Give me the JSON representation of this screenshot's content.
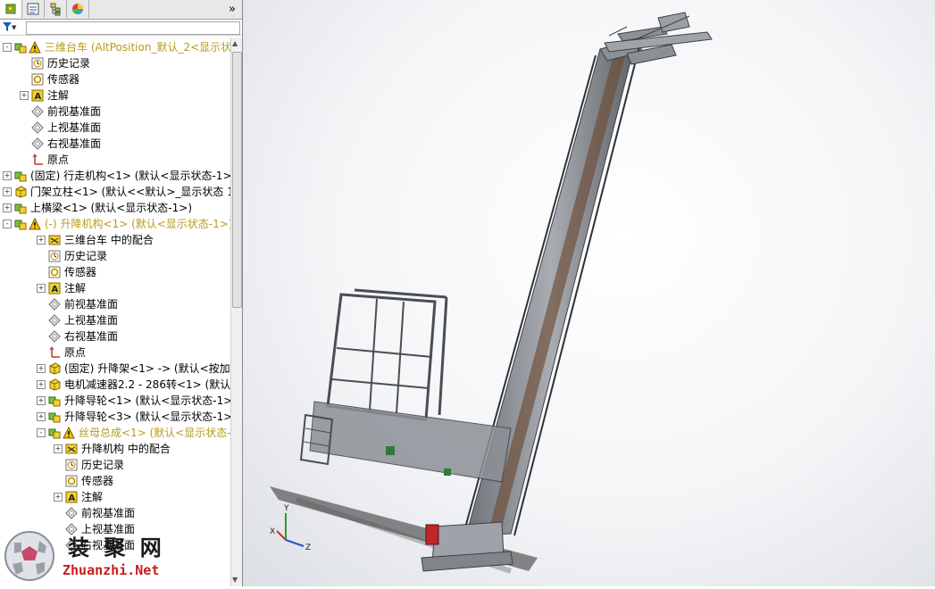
{
  "panel": {
    "tabs": [
      "feature-manager-tab",
      "property-manager-tab",
      "configuration-manager-tab",
      "display-manager-tab"
    ],
    "more_label": "»",
    "filter_icon_label": "▼"
  },
  "tree": {
    "rows": [
      {
        "label": "三维台车  (AltPosition_默认_2<显示状态-",
        "indent": 0,
        "expand": "-",
        "icon": "assembly-icon",
        "warn": true,
        "yellow": true
      },
      {
        "label": "历史记录",
        "indent": 1,
        "expand": "",
        "icon": "history-icon",
        "warn": false,
        "yellow": false
      },
      {
        "label": "传感器",
        "indent": 1,
        "expand": "",
        "icon": "sensor-icon",
        "warn": false,
        "yellow": false
      },
      {
        "label": "注解",
        "indent": 1,
        "expand": "+",
        "icon": "annotation-icon",
        "warn": false,
        "yellow": false
      },
      {
        "label": "前视基准面",
        "indent": 1,
        "expand": "",
        "icon": "plane-icon",
        "warn": false,
        "yellow": false
      },
      {
        "label": "上视基准面",
        "indent": 1,
        "expand": "",
        "icon": "plane-icon",
        "warn": false,
        "yellow": false
      },
      {
        "label": "右视基准面",
        "indent": 1,
        "expand": "",
        "icon": "plane-icon",
        "warn": false,
        "yellow": false
      },
      {
        "label": "原点",
        "indent": 1,
        "expand": "",
        "icon": "origin-icon",
        "warn": false,
        "yellow": false
      },
      {
        "label": "(固定) 行走机构<1> (默认<显示状态-1>",
        "indent": 0,
        "expand": "+",
        "icon": "assembly-icon",
        "warn": false,
        "yellow": false
      },
      {
        "label": "门架立柱<1> (默认<<默认>_显示状态 1",
        "indent": 0,
        "expand": "+",
        "icon": "part-icon",
        "warn": false,
        "yellow": false
      },
      {
        "label": "上横梁<1> (默认<显示状态-1>)",
        "indent": 0,
        "expand": "+",
        "icon": "assembly-icon",
        "warn": false,
        "yellow": false
      },
      {
        "label": "(-) 升降机构<1> (默认<显示状态-1>)",
        "indent": 0,
        "expand": "-",
        "icon": "assembly-icon",
        "warn": true,
        "yellow": true
      },
      {
        "label": "三维台车 中的配合",
        "indent": 2,
        "expand": "+",
        "icon": "mates-icon",
        "warn": false,
        "yellow": false
      },
      {
        "label": "历史记录",
        "indent": 2,
        "expand": "",
        "icon": "history-icon",
        "warn": false,
        "yellow": false
      },
      {
        "label": "传感器",
        "indent": 2,
        "expand": "",
        "icon": "sensor-icon",
        "warn": false,
        "yellow": false
      },
      {
        "label": "注解",
        "indent": 2,
        "expand": "+",
        "icon": "annotation-icon",
        "warn": false,
        "yellow": false
      },
      {
        "label": "前视基准面",
        "indent": 2,
        "expand": "",
        "icon": "plane-icon",
        "warn": false,
        "yellow": false
      },
      {
        "label": "上视基准面",
        "indent": 2,
        "expand": "",
        "icon": "plane-icon",
        "warn": false,
        "yellow": false
      },
      {
        "label": "右视基准面",
        "indent": 2,
        "expand": "",
        "icon": "plane-icon",
        "warn": false,
        "yellow": false
      },
      {
        "label": "原点",
        "indent": 2,
        "expand": "",
        "icon": "origin-icon",
        "warn": false,
        "yellow": false
      },
      {
        "label": "(固定) 升降架<1> -> (默认<按加工>",
        "indent": 2,
        "expand": "+",
        "icon": "part-icon",
        "warn": false,
        "yellow": false
      },
      {
        "label": "电机减速器2.2 - 286转<1> (默认<<默",
        "indent": 2,
        "expand": "+",
        "icon": "part-icon",
        "warn": false,
        "yellow": false
      },
      {
        "label": "升降导轮<1> (默认<显示状态-1>)",
        "indent": 2,
        "expand": "+",
        "icon": "assembly-icon",
        "warn": false,
        "yellow": false
      },
      {
        "label": "升降导轮<3> (默认<显示状态-1>)",
        "indent": 2,
        "expand": "+",
        "icon": "assembly-icon",
        "warn": false,
        "yellow": false
      },
      {
        "label": "丝母总成<1> (默认<显示状态-1>",
        "indent": 2,
        "expand": "-",
        "icon": "assembly-icon",
        "warn": true,
        "yellow": true
      },
      {
        "label": "升降机构 中的配合",
        "indent": 3,
        "expand": "+",
        "icon": "mates-icon",
        "warn": false,
        "yellow": false
      },
      {
        "label": "历史记录",
        "indent": 3,
        "expand": "",
        "icon": "history-icon",
        "warn": false,
        "yellow": false
      },
      {
        "label": "传感器",
        "indent": 3,
        "expand": "",
        "icon": "sensor-icon",
        "warn": false,
        "yellow": false
      },
      {
        "label": "注解",
        "indent": 3,
        "expand": "+",
        "icon": "annotation-icon",
        "warn": false,
        "yellow": false
      },
      {
        "label": "前视基准面",
        "indent": 3,
        "expand": "",
        "icon": "plane-icon",
        "warn": false,
        "yellow": false
      },
      {
        "label": "上视基准面",
        "indent": 3,
        "expand": "",
        "icon": "plane-icon",
        "warn": false,
        "yellow": false
      },
      {
        "label": "右视基准面",
        "indent": 3,
        "expand": "",
        "icon": "plane-icon",
        "warn": false,
        "yellow": false
      }
    ]
  },
  "viewport": {
    "triad": {
      "x": "X",
      "y": "Y",
      "z": "Z"
    }
  },
  "watermark": {
    "cn": "装 聚 网",
    "en": "Zhuanzhi.Net"
  },
  "colors": {
    "accent": "#1c5fb0",
    "warning": "#f2c200",
    "yellow_text": "#b89a1c",
    "steel": "#8c9096"
  }
}
